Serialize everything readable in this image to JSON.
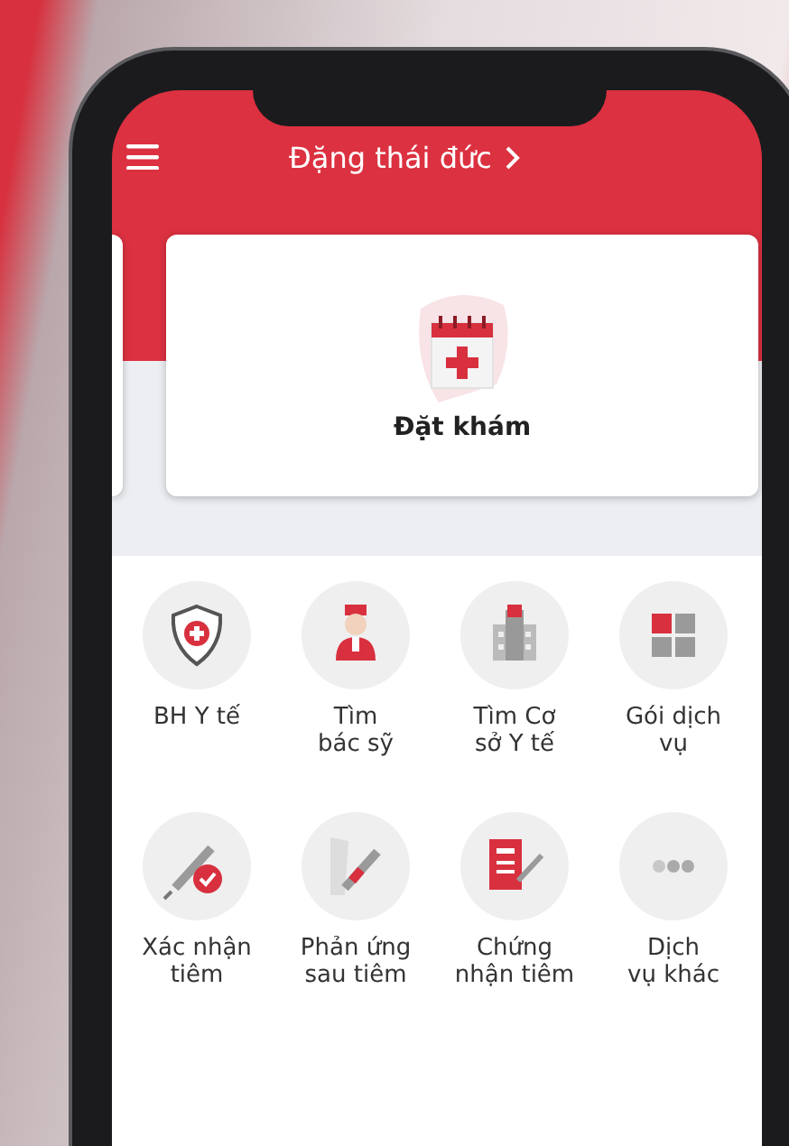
{
  "header": {
    "title": "Đặng thái đức"
  },
  "booking_card": {
    "label": "Đặt khám"
  },
  "services": [
    {
      "kind": "insurance",
      "label": "BH Y tế"
    },
    {
      "kind": "doctor",
      "label": "Tìm\nbác sỹ"
    },
    {
      "kind": "facility",
      "label": "Tìm Cơ\nsở Y tế"
    },
    {
      "kind": "package",
      "label": "Gói dịch\nvụ"
    },
    {
      "kind": "vaccine_confirm",
      "label": "Xác nhận\ntiêm"
    },
    {
      "kind": "reaction",
      "label": "Phản ứng\nsau tiêm"
    },
    {
      "kind": "certificate",
      "label": "Chứng\nnhận tiêm"
    },
    {
      "kind": "more",
      "label": "Dịch\nvụ khác"
    }
  ]
}
